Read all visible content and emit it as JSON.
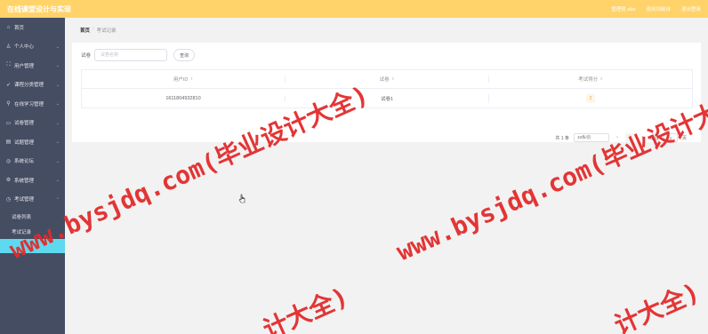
{
  "header": {
    "app_title": "在线课堂设计与实现",
    "user_label": "管理员 abo",
    "home_link": "退出到前台",
    "logout_link": "退出登录"
  },
  "sidebar": {
    "items": [
      {
        "label": "首页",
        "icon": "home-icon"
      },
      {
        "label": "个人中心",
        "icon": "user-icon"
      },
      {
        "label": "用户管理",
        "icon": "users-icon"
      },
      {
        "label": "课程分类管理",
        "icon": "send-icon"
      },
      {
        "label": "在线学习管理",
        "icon": "pin-icon"
      },
      {
        "label": "试卷管理",
        "icon": "doc-icon"
      },
      {
        "label": "试题管理",
        "icon": "list-icon"
      },
      {
        "label": "系统论坛",
        "icon": "chat-icon"
      },
      {
        "label": "系统管理",
        "icon": "gear-icon"
      },
      {
        "label": "考试管理",
        "icon": "clock-icon"
      }
    ],
    "subitems": [
      {
        "label": "试卷列表"
      },
      {
        "label": "考试记录"
      }
    ]
  },
  "breadcrumb": {
    "home": "首页",
    "separator": "/",
    "current": "考试记录"
  },
  "search": {
    "label": "试卷",
    "placeholder": "试卷名称",
    "query_button": "查询"
  },
  "table": {
    "columns": [
      "用户ID",
      "试卷",
      "考试得分"
    ],
    "rows": [
      {
        "user_id": "1611804932810",
        "paper": "试卷1",
        "score": "2"
      }
    ]
  },
  "pagination": {
    "total": "共 1 条",
    "page_size": "10条/页",
    "prev": "<",
    "page": "1",
    "next": ">",
    "goto_label": "前往",
    "goto_value": "1",
    "page_unit": "页"
  },
  "watermark": {
    "text_a": "www.bysjdq.com(毕业设计大全)",
    "text_b": "计大全)",
    "color": "#e32b2b"
  },
  "colors": {
    "accent": "#ffd369",
    "sidebar_bg": "#454d63",
    "active_bg": "#5fd9ef"
  }
}
